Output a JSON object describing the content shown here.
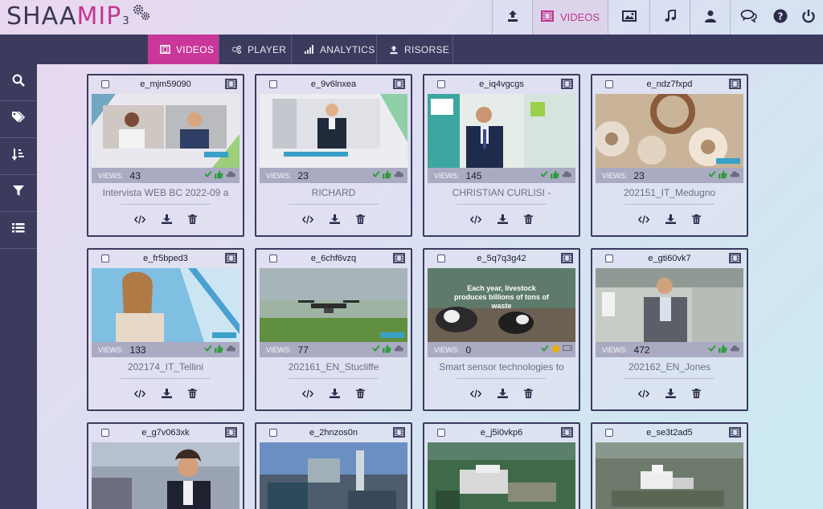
{
  "app": {
    "logo_main": "SHAA",
    "logo_accent": "MIP",
    "logo_version": "3"
  },
  "topnav": {
    "videos_label": "VIDEOS"
  },
  "navbar": {
    "tabs": [
      {
        "label": "VIDEOS",
        "icon": "film-icon",
        "active": true
      },
      {
        "label": "PLAYER",
        "icon": "gears-icon",
        "active": false
      },
      {
        "label": "ANALYTICS",
        "icon": "bar-chart-icon",
        "active": false
      },
      {
        "label": "RISORSE",
        "icon": "upload-icon",
        "active": false
      }
    ]
  },
  "sidebar": {
    "items": [
      "search-icon",
      "tags-icon",
      "sort-icon",
      "filter-icon",
      "list-icon"
    ]
  },
  "views_label": "VIEWS:",
  "colors": {
    "accent": "#c9379a",
    "nav_bg": "#3b3b5e",
    "status_green": "#2e9e3e",
    "status_yellow": "#e0b020"
  },
  "cards": [
    {
      "id": "e_mjm59090",
      "views": "43",
      "title": "Intervista WEB BC 2022-09 a"
    },
    {
      "id": "e_9v6lnxea",
      "views": "23",
      "title": "RICHARD"
    },
    {
      "id": "e_iq4vgcgs",
      "views": "145",
      "title": "CHRISTIAN CURLISI -"
    },
    {
      "id": "e_ndz7fxpd",
      "views": "23",
      "title": "202151_IT_Medugno"
    },
    {
      "id": "e_fr5bped3",
      "views": "133",
      "title": "202174_IT_Tellini"
    },
    {
      "id": "e_6chf6vzq",
      "views": "77",
      "title": "202161_EN_Stucliffe"
    },
    {
      "id": "e_5q7q3g42",
      "views": "0",
      "title": "Smart sensor technologies to",
      "thumb_text": "Each year, livestock produces billions of tons of waste"
    },
    {
      "id": "e_gti60vk7",
      "views": "472",
      "title": "202162_EN_Jones"
    },
    {
      "id": "e_g7v063xk"
    },
    {
      "id": "e_2hnzos0n"
    },
    {
      "id": "e_j5i0vkp6"
    },
    {
      "id": "e_se3t2ad5"
    }
  ]
}
